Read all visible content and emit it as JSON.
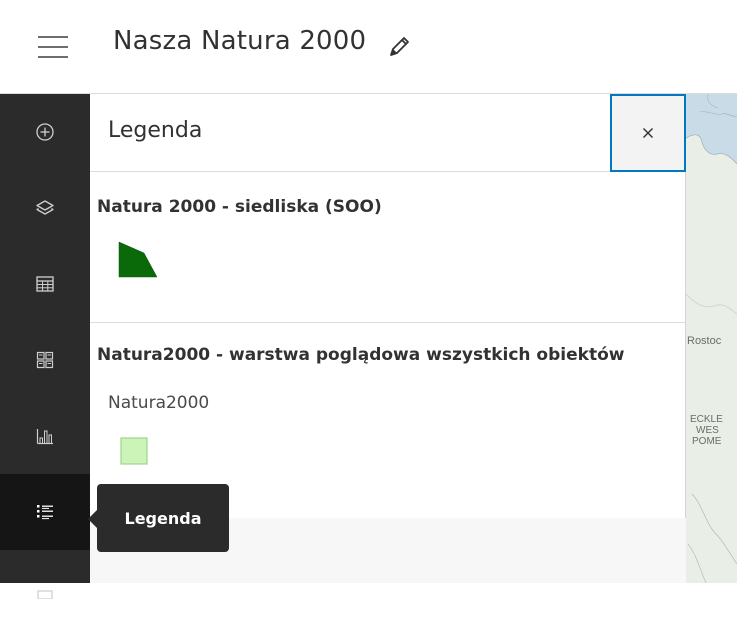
{
  "header": {
    "title": "Nasza Natura 2000",
    "menu_icon": "hamburger-menu-icon",
    "edit_icon": "pencil-icon"
  },
  "action_bar": {
    "items": [
      {
        "name": "add",
        "icon": "add-circle-icon"
      },
      {
        "name": "layers",
        "icon": "layers-icon"
      },
      {
        "name": "table",
        "icon": "table-icon"
      },
      {
        "name": "basemap",
        "icon": "basemap-grid-icon"
      },
      {
        "name": "chart",
        "icon": "bar-chart-icon"
      },
      {
        "name": "legend",
        "icon": "legend-list-icon",
        "active": true
      },
      {
        "name": "more",
        "icon": "partial-icon"
      }
    ],
    "background": "#2b2b2b",
    "active_background": "#151515"
  },
  "panel": {
    "title": "Legenda",
    "close_label": "×",
    "close_border_color": "#0079c1",
    "layers": [
      {
        "title": "Natura 2000 - siedliska (SOO)",
        "symbol_color": "#0a6a0a"
      },
      {
        "title": "Natura2000 - warstwa poglądowa wszystkich obiektów",
        "sub_label": "Natura2000",
        "symbol_color": "#ccf3b8",
        "symbol_outline": "#9bd88a"
      }
    ]
  },
  "tooltip": {
    "text": "Legenda"
  },
  "map": {
    "labels": [
      "Rostoc",
      "ECKLE",
      "WES",
      "POME"
    ]
  }
}
